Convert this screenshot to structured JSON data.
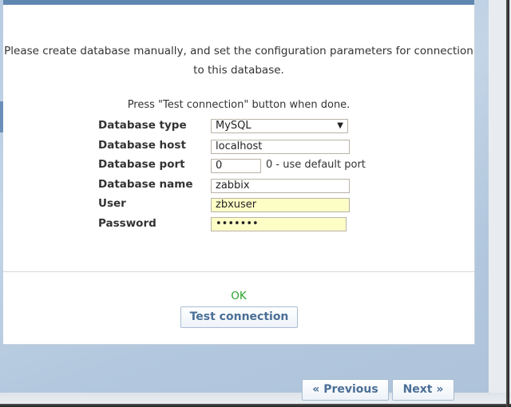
{
  "intro": {
    "line1": "Please create database manually, and set the configuration parameters for connection",
    "line2": "to this database."
  },
  "instruction": "Press \"Test connection\" button when done.",
  "form": {
    "db_type": {
      "label": "Database type",
      "value": "MySQL",
      "arrow": "▼"
    },
    "db_host": {
      "label": "Database host",
      "value": "localhost"
    },
    "db_port": {
      "label": "Database port",
      "value": "0",
      "hint": "0 - use default port"
    },
    "db_name": {
      "label": "Database name",
      "value": "zabbix"
    },
    "user": {
      "label": "User",
      "value": "zbxuser"
    },
    "password": {
      "label": "Password",
      "value": "•••••••"
    }
  },
  "status": {
    "text": "OK",
    "color": "#2aa52a"
  },
  "buttons": {
    "test_connection": "Test connection",
    "previous": "« Previous",
    "next": "Next »"
  },
  "colors": {
    "accent": "#5f87b0",
    "button_text": "#4a6f96",
    "autofill": "#fdfdc6"
  }
}
